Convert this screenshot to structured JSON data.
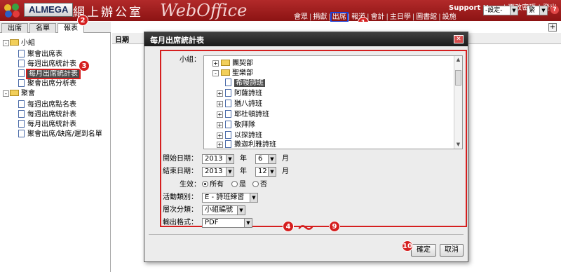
{
  "header": {
    "brand": "ALMEGA",
    "brand_chinese": "網上辦公室",
    "brand_webo": "WebOffice",
    "user": "Support User",
    "links": [
      "更改密碼",
      "登出"
    ],
    "nav": [
      "會眾",
      "捐獻",
      "出席",
      "報道",
      "會計",
      "主日學",
      "圖書館",
      "設施"
    ],
    "active_nav_index": 2,
    "settings_select": "-設定-",
    "lang_select": "繁",
    "help_label": "?"
  },
  "left": {
    "tabs": [
      "出席",
      "名單",
      "報表"
    ],
    "active_tab_index": 2,
    "tree": [
      {
        "label": "小組",
        "type": "folder"
      },
      {
        "label": "聚會出席表",
        "type": "doc"
      },
      {
        "label": "每週出席統計表",
        "type": "doc"
      },
      {
        "label": "每月出席統計表",
        "type": "doc",
        "selected": true
      },
      {
        "label": "聚會出席分析表",
        "type": "doc"
      },
      {
        "label": "聚會",
        "type": "folder"
      },
      {
        "label": "每週出席點名表",
        "type": "doc"
      },
      {
        "label": "每週出席統計表",
        "type": "doc"
      },
      {
        "label": "每月出席統計表",
        "type": "doc"
      },
      {
        "label": "聚會出席/缺席/遲到名單",
        "type": "doc"
      }
    ]
  },
  "main": {
    "header_col": "日期",
    "add_label": "+"
  },
  "modal": {
    "title": "每月出席統計表",
    "close_label": "✕",
    "group_label": "小組：",
    "tree": [
      {
        "label": "團契部",
        "level": 0,
        "folder": true,
        "expand": "+"
      },
      {
        "label": "聖樂部",
        "level": 0,
        "folder": true,
        "expand": "-"
      },
      {
        "label": "希幔詩班",
        "level": 1,
        "selected": true
      },
      {
        "label": "阿薩詩班",
        "level": 1
      },
      {
        "label": "猶八詩班",
        "level": 1
      },
      {
        "label": "耶杜頓詩班",
        "level": 1
      },
      {
        "label": "敬拜隊",
        "level": 1
      },
      {
        "label": "以探詩班",
        "level": 1
      },
      {
        "label": "撒迦利雅詩班",
        "level": 1
      }
    ],
    "start_label": "開始日期：",
    "start_year": "2013",
    "start_month": "6",
    "end_label": "結束日期：",
    "end_year": "2013",
    "end_month": "12",
    "year_unit": "年",
    "month_unit": "月",
    "student_label": "生效：",
    "student_options": [
      "所有",
      "是",
      "否"
    ],
    "student_selected": 0,
    "activity_label": "活動類別：",
    "activity_value": "E - 詩班練習",
    "level_label": "層次分類：",
    "level_value": "小組編號",
    "output_label": "輸出格式：",
    "output_value": "PDF",
    "ok_label": "確定",
    "cancel_label": "取消"
  },
  "annotations": {
    "badges": [
      "1",
      "2",
      "3",
      "4",
      "9",
      "10"
    ],
    "range_mark": "～"
  },
  "colors": {
    "header_red": "#a81e1e",
    "highlight_red": "#d51f1f",
    "highlight_blue": "#1d3fd6",
    "selected_bg": "#4a4a4a"
  }
}
